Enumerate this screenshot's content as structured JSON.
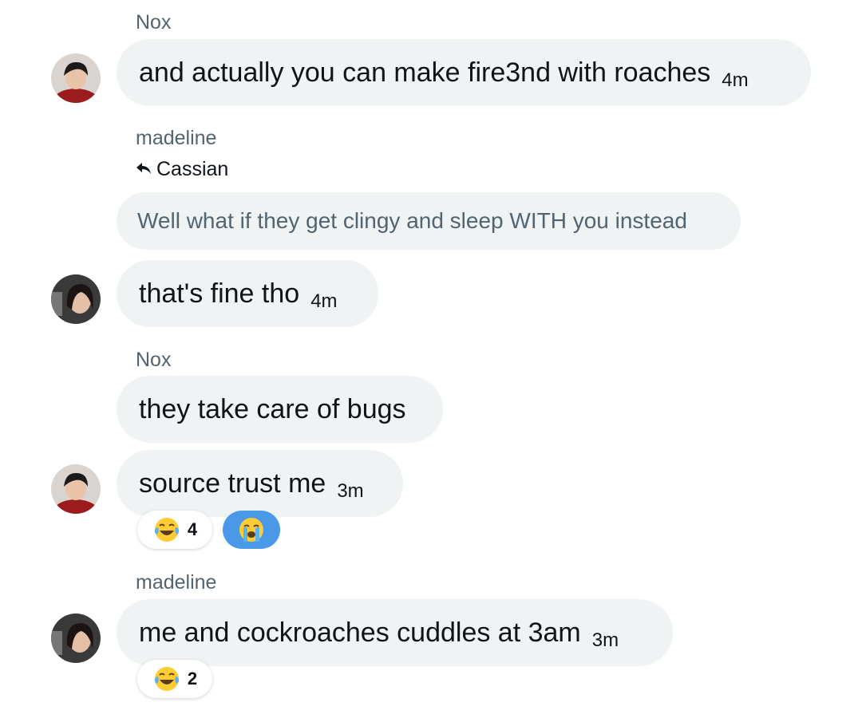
{
  "messages": [
    {
      "sender": "Nox",
      "text": "and actually you can make fire3nd with roaches",
      "time": "4m"
    },
    {
      "sender": "madeline",
      "reply_to": "Cassian",
      "quoted": "Well what if they get clingy and sleep WITH you instead",
      "text": "that's fine tho",
      "time": "4m"
    },
    {
      "sender": "Nox",
      "text": "they take care of bugs"
    },
    {
      "text": "source trust me",
      "time": "3m",
      "reactions": [
        {
          "emoji": "face-with-tears-of-joy",
          "count": "4"
        },
        {
          "emoji": "loudly-crying-face",
          "selected": true
        }
      ]
    },
    {
      "sender": "madeline",
      "text": "me and cockroaches cuddles at 3am",
      "time": "3m",
      "reactions": [
        {
          "emoji": "face-with-tears-of-joy",
          "count": "2"
        }
      ]
    }
  ],
  "colors": {
    "bubble": "#eff3f4",
    "meta_text": "#536471",
    "selected_reaction": "#4a99e9"
  }
}
